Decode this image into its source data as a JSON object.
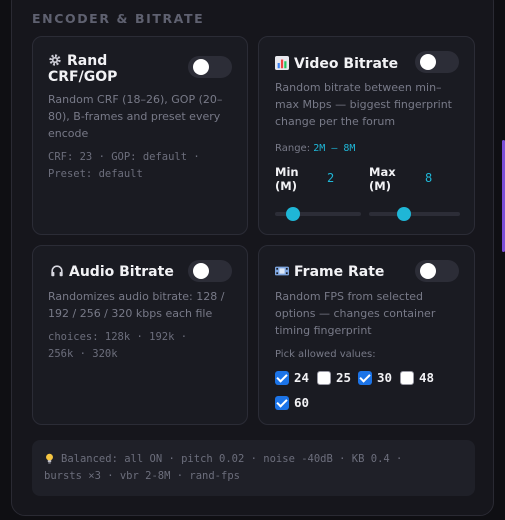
{
  "section": {
    "title": "ENCODER & BITRATE"
  },
  "colors": {
    "accent": "#1fb6d6",
    "checkbox": "#1c74e8",
    "edge_accent": "#7b4fd8"
  },
  "cards": {
    "rand_crf": {
      "icon": "gear-icon",
      "title_line1": "Rand",
      "title_line2": "CRF/GOP",
      "toggle_on": false,
      "desc": [
        "Random CRF (18–26), GOP (20–",
        "80), B-frames and preset every",
        "encode"
      ],
      "mono": [
        "CRF: 23 · GOP: default ·",
        "Preset: default"
      ]
    },
    "video_bitrate": {
      "icon": "chart-icon",
      "title": "Video Bitrate",
      "toggle_on": false,
      "desc": [
        "Random bitrate between min–",
        "max Mbps — biggest fingerprint",
        "change per the forum"
      ],
      "range_label": "Range:",
      "range_value": "2M – 8M",
      "min_label_1": "Min",
      "min_label_2": "(M)",
      "min_value": "2",
      "max_label_1": "Max",
      "max_label_2": "(M)",
      "max_value": "8",
      "min_slider_fraction": 0.21,
      "max_slider_fraction": 0.38
    },
    "audio_bitrate": {
      "icon": "headphones-icon",
      "title": "Audio Bitrate",
      "toggle_on": false,
      "desc": [
        "Randomizes audio bitrate: 128 /",
        "192 / 256 / 320 kbps each file"
      ],
      "mono": [
        "choices: 128k · 192k ·",
        "256k · 320k"
      ]
    },
    "frame_rate": {
      "icon": "film-icon",
      "title": "Frame Rate",
      "toggle_on": false,
      "desc": [
        "Random FPS from selected",
        "options — changes container",
        "timing fingerprint"
      ],
      "pick_label": "Pick allowed values:",
      "fps": [
        {
          "value": "24",
          "checked": true
        },
        {
          "value": "25",
          "checked": false
        },
        {
          "value": "30",
          "checked": true
        },
        {
          "value": "48",
          "checked": false
        },
        {
          "value": "60",
          "checked": true
        }
      ]
    }
  },
  "footer": {
    "icon": "lightbulb-icon",
    "line1": "Balanced: all ON · pitch 0.02 · noise -40dB · KB 0.4 ·",
    "line2": "bursts ×3 · vbr 2-8M · rand-fps"
  }
}
